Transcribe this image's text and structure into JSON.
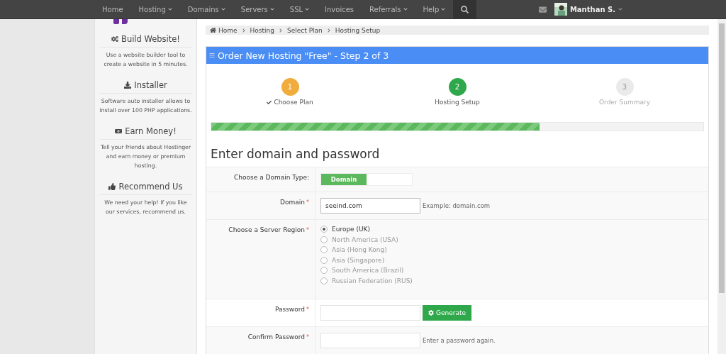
{
  "navbar": {
    "items": [
      {
        "label": "Home",
        "dropdown": false
      },
      {
        "label": "Hosting",
        "dropdown": true
      },
      {
        "label": "Domains",
        "dropdown": true
      },
      {
        "label": "Servers",
        "dropdown": true
      },
      {
        "label": "SSL",
        "dropdown": true
      },
      {
        "label": "Invoices",
        "dropdown": false
      },
      {
        "label": "Referrals",
        "dropdown": true
      },
      {
        "label": "Help",
        "dropdown": true
      }
    ],
    "user": "Manthan S."
  },
  "sidebar": {
    "sections": [
      {
        "kind": "builder",
        "title": "Build Website!",
        "text": "Use a website builder tool to create a website in 5 minutes."
      },
      {
        "kind": "installer",
        "title": "Installer",
        "text": "Software auto installer allows to install over 100 PHP applications."
      },
      {
        "kind": "money",
        "title": "Earn Money!",
        "text": "Tell your friends about Hostinger and earn money or premium hosting."
      },
      {
        "kind": "recommend",
        "title": "Recommend Us",
        "text": "We need your help! If you like our services, recommend us."
      }
    ]
  },
  "breadcrumb": [
    "Home",
    "Hosting",
    "Select Plan",
    "Hosting Setup"
  ],
  "panel": {
    "title": "Order New Hosting \"Free\" - Step 2 of 3",
    "steps": [
      {
        "number": "1",
        "label": "Choose Plan",
        "kind": "done"
      },
      {
        "number": "2",
        "label": "Hosting Setup",
        "kind": "active"
      },
      {
        "number": "3",
        "label": "Order Summary",
        "kind": "pending"
      }
    ],
    "progress": {
      "level": 0.667
    },
    "heading": "Enter domain and password",
    "form": [
      {
        "kind": "toggle",
        "label": "Choose a Domain Type:",
        "options": [
          {
            "label": "Domain",
            "selected": true
          },
          {
            "selected": false
          }
        ]
      },
      {
        "kind": "text",
        "label": "Domain",
        "required_mark": "*",
        "value": "seeind.com",
        "hint": "Example: domain.com"
      },
      {
        "kind": "radio",
        "label": "Choose a Server Region",
        "required_mark": "*",
        "options": [
          {
            "label": "Europe (UK)",
            "selected": true
          },
          {
            "label": "North America (USA)",
            "selected": false
          },
          {
            "label": "Asia (Hong Kong)",
            "selected": false
          },
          {
            "label": "Asia (Singapore)",
            "selected": false
          },
          {
            "label": "South America (Brazil)",
            "selected": false
          },
          {
            "label": "Russian Federation (RUS)",
            "selected": false
          }
        ]
      },
      {
        "kind": "password",
        "label": "Password",
        "required_mark": "*",
        "button": "Generate"
      },
      {
        "kind": "password",
        "label": "Confirm Password",
        "required_mark": "*",
        "hint": "Enter a password again."
      }
    ]
  }
}
